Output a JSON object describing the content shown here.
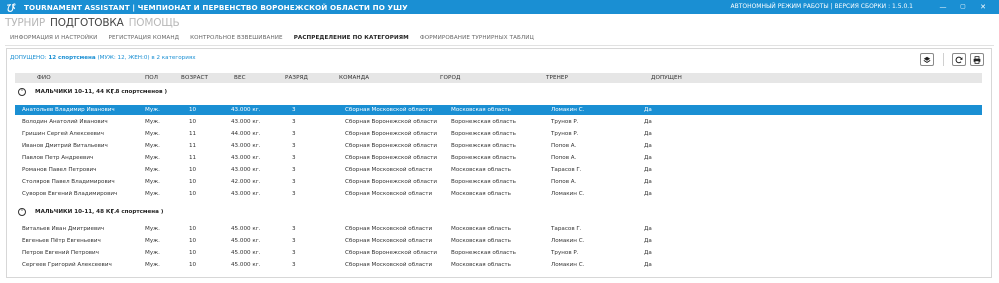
{
  "window": {
    "title": "TOURNAMENT ASSISTANT | ЧЕМПИОНАТ И ПЕРВЕНСТВО ВОРОНЕЖСКОЙ ОБЛАСТИ ПО УШУ",
    "build_info": "АВТОНОМНЫЙ РЕЖИМ РАБОТЫ | ВЕРСИЯ СБОРКИ : 1.5.0.1",
    "controls": [
      "—",
      "▢",
      "✕"
    ]
  },
  "main_menu": [
    "ТУРНИР",
    "ПОДГОТОВКА",
    "ПОМОЩЬ"
  ],
  "sub_menu": [
    "ИНФОРМАЦИЯ И НАСТРОЙКИ",
    "РЕГИСТРАЦИЯ КОМАНД",
    "КОНТРОЛЬНОЕ ВЗВЕШИВАНИЕ",
    "РАСПРЕДЕЛЕНИЕ ПО КАТЕГОРИЯМ",
    "ФОРМИРОВАНИЕ ТУРНИРНЫХ ТАБЛИЦ"
  ],
  "summary": {
    "label": "ДОПУЩЕНО:",
    "value": "12 спортсмена",
    "detail": "(МУЖ: 12, ЖЕН:0)",
    "categories": "в 2 категориях"
  },
  "toolbar": {
    "layers_icon": "layers-icon",
    "refresh_icon": "refresh-icon",
    "print_icon": "print-icon"
  },
  "columns": {
    "fio": "ФИО",
    "sex": "ПОЛ",
    "age": "ВОЗРАСТ",
    "weight": "ВЕС",
    "rank": "РАЗРЯД",
    "team": "КОМАНДА",
    "city": "ГОРОД",
    "coach": "ТРЕНЕР",
    "admitted": "ДОПУЩЕН"
  },
  "groups": [
    {
      "name": "МАЛЬЧИКИ 10-11, 44 КГ.",
      "count": "( 8 спортсменов )",
      "rows": [
        {
          "fio": "Анатольев Владимир Иванович",
          "sex": "Муж.",
          "age": "10",
          "weight": "43.000 кг.",
          "rank": "3",
          "team": "Сборная Московской области",
          "city": "Московская область",
          "coach": "Ломакин С.",
          "admitted": "Да"
        },
        {
          "fio": "Володин Анатолий Иванович",
          "sex": "Муж.",
          "age": "10",
          "weight": "43.000 кг.",
          "rank": "3",
          "team": "Сборная Воронежской области",
          "city": "Воронежская область",
          "coach": "Трунов Р.",
          "admitted": "Да"
        },
        {
          "fio": "Гришин Сергей Алексеевич",
          "sex": "Муж.",
          "age": "11",
          "weight": "44.000 кг.",
          "rank": "3",
          "team": "Сборная Воронежской области",
          "city": "Воронежская область",
          "coach": "Трунов Р.",
          "admitted": "Да"
        },
        {
          "fio": "Иванов Дмитрий Витальевич",
          "sex": "Муж.",
          "age": "11",
          "weight": "43.000 кг.",
          "rank": "3",
          "team": "Сборная Воронежской области",
          "city": "Воронежская область",
          "coach": "Попов А.",
          "admitted": "Да"
        },
        {
          "fio": "Павлов Петр Андреевич",
          "sex": "Муж.",
          "age": "11",
          "weight": "43.000 кг.",
          "rank": "3",
          "team": "Сборная Воронежской области",
          "city": "Воронежская область",
          "coach": "Попов А.",
          "admitted": "Да"
        },
        {
          "fio": "Романов Павел Петрович",
          "sex": "Муж.",
          "age": "10",
          "weight": "43.000 кг.",
          "rank": "3",
          "team": "Сборная Московской области",
          "city": "Московская область",
          "coach": "Тарасов Г.",
          "admitted": "Да"
        },
        {
          "fio": "Столяров Павел Владимирович",
          "sex": "Муж.",
          "age": "10",
          "weight": "42.000 кг.",
          "rank": "3",
          "team": "Сборная Воронежской области",
          "city": "Воронежская область",
          "coach": "Попов А.",
          "admitted": "Да"
        },
        {
          "fio": "Суворов Евгений Владимирович",
          "sex": "Муж.",
          "age": "10",
          "weight": "43.000 кг.",
          "rank": "3",
          "team": "Сборная Московской области",
          "city": "Московская область",
          "coach": "Ломакин С.",
          "admitted": "Да"
        }
      ]
    },
    {
      "name": "МАЛЬЧИКИ 10-11, 48 КГ.",
      "count": "( 4 спортсмена )",
      "rows": [
        {
          "fio": "Витальев Иван Дмитриевич",
          "sex": "Муж.",
          "age": "10",
          "weight": "45.000 кг.",
          "rank": "3",
          "team": "Сборная Московской области",
          "city": "Московская область",
          "coach": "Тарасов Г.",
          "admitted": "Да"
        },
        {
          "fio": "Евгеньев Пётр Евгеньевич",
          "sex": "Муж.",
          "age": "10",
          "weight": "45.000 кг.",
          "rank": "3",
          "team": "Сборная Московской области",
          "city": "Московская область",
          "coach": "Ломакин С.",
          "admitted": "Да"
        },
        {
          "fio": "Петров Евгений Петрович",
          "sex": "Муж.",
          "age": "10",
          "weight": "45.000 кг.",
          "rank": "3",
          "team": "Сборная Воронежской области",
          "city": "Воронежская область",
          "coach": "Трунов Р.",
          "admitted": "Да"
        },
        {
          "fio": "Сергеев Григорий Алексеевич",
          "sex": "Муж.",
          "age": "10",
          "weight": "45.000 кг.",
          "rank": "3",
          "team": "Сборная Московской области",
          "city": "Московская область",
          "coach": "Ломакин С.",
          "admitted": "Да"
        }
      ]
    }
  ]
}
